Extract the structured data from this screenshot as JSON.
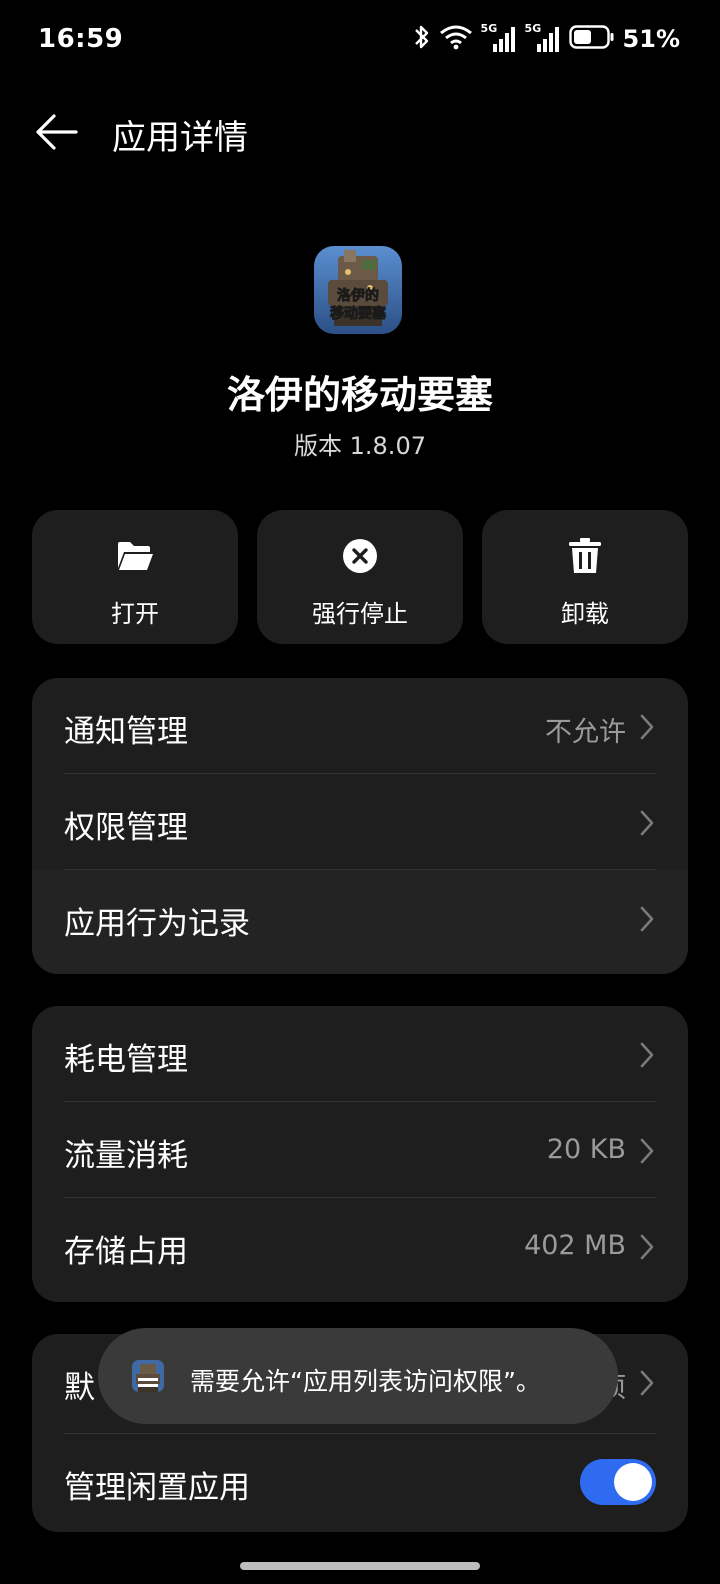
{
  "status_bar": {
    "time": "16:59",
    "signal_1_label": "5G",
    "signal_2_label": "5G",
    "battery_percent": "51%"
  },
  "header": {
    "title": "应用详情"
  },
  "app": {
    "name": "洛伊的移动要塞",
    "version": "版本 1.8.07",
    "icon_text_line1": "洛伊的",
    "icon_text_line2": "移动要塞"
  },
  "actions": [
    {
      "label": "打开",
      "icon": "folder-open-icon"
    },
    {
      "label": "强行停止",
      "icon": "close-circle-icon"
    },
    {
      "label": "卸载",
      "icon": "trash-icon"
    }
  ],
  "group1": [
    {
      "label": "通知管理",
      "value": "不允许"
    },
    {
      "label": "权限管理",
      "value": ""
    },
    {
      "label": "应用行为记录",
      "value": ""
    }
  ],
  "group2": [
    {
      "label": "耗电管理",
      "value": ""
    },
    {
      "label": "流量消耗",
      "value": "20 KB"
    },
    {
      "label": "存储占用",
      "value": "402 MB"
    }
  ],
  "group3": {
    "row1_label_visible": "默",
    "row1_value_visible": "项",
    "row2_label": "管理闲置应用",
    "row2_toggle_on": true
  },
  "toast": {
    "text": "需要允许“应用列表访问权限”。"
  },
  "colors": {
    "background": "#000000",
    "card": "#1e1e1e",
    "toggle_on": "#2f6bf0",
    "secondary_text": "#9a9a9a",
    "toast_bg": "#3a3a3a"
  }
}
